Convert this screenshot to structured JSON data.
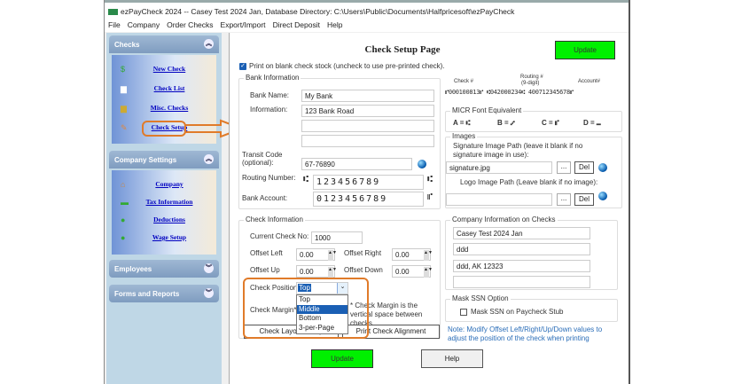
{
  "window": {
    "title": "ezPayCheck 2024 -- Casey Test 2024 Jan, Database Directory: C:\\Users\\Public\\Documents\\Halfpricesoft\\ezPayCheck"
  },
  "menu": [
    "File",
    "Company",
    "Order Checks",
    "Export/Import",
    "Direct Deposit",
    "Help"
  ],
  "sidebar": {
    "checks": {
      "title": "Checks",
      "items": [
        "New Check",
        "Check List",
        "Misc. Checks",
        "Check Setup"
      ]
    },
    "company_settings": {
      "title": "Company Settings",
      "items": [
        "Company",
        "Tax Information",
        "Deductions",
        "Wage Setup"
      ]
    },
    "employees": {
      "title": "Employees"
    },
    "forms": {
      "title": "Forms and Reports"
    }
  },
  "page": {
    "title": "Check Setup Page",
    "update_label": "Update",
    "help_label": "Help",
    "blank_stock_label": "Print on blank check stock (uncheck to use pre-printed check).",
    "blank_stock_checked": true
  },
  "bank": {
    "legend": "Bank Information",
    "name_label": "Bank Name:",
    "name": "My Bank",
    "info_label": "Information:",
    "info1": "123 Bank Road",
    "info2": "",
    "info3": "",
    "transit_label1": "Transit Code",
    "transit_label2": "(optional):",
    "transit": "67-76890",
    "routing_label": "Routing Number:",
    "routing": "123456789",
    "account_label": "Bank Account:",
    "account": "0123456789"
  },
  "micr_sample": {
    "check_label": "Check #",
    "routing_label": "Routing #",
    "routing_sub": "(9-digit)",
    "account_label": "Account#",
    "line": "⑈000100813⑈ ⑆042000234⑆ 400712345678⑈"
  },
  "micr_font": {
    "legend": "MICR Font Equivalent",
    "a": "A = ⑆",
    "b": "B = ⑇",
    "c": "C = ⑈",
    "d": "D = ⑉"
  },
  "images": {
    "legend": "Images",
    "sig_label": "Signature Image Path (leave it blank if no signature image in use):",
    "sig": "signature.jpg",
    "logo_label": "Logo Image Path (Leave blank if no image):",
    "logo": "",
    "browse": "...",
    "del": "Del"
  },
  "check_info": {
    "legend": "Check Information",
    "current_label": "Current Check No:",
    "current": "1000",
    "offset_left_label": "Offset Left",
    "offset_left": "0.00",
    "offset_right_label": "Offset Right",
    "offset_right": "0.00",
    "offset_up_label": "Offset Up",
    "offset_up": "0.00",
    "offset_down_label": "Offset Down",
    "offset_down": "0.00",
    "position_label": "Check Position",
    "position": "Top",
    "position_options": [
      "Top",
      "Middle",
      "Bottom",
      "3-per-Page"
    ],
    "margin_label": "Check Margin*:",
    "margin_note": "* Check Margin is the vertical space between checks.",
    "layout_btn": "Check Layout Setup",
    "align_btn": "Print Check Alignment"
  },
  "company_info": {
    "legend": "Company Information on Checks",
    "lines": [
      "Casey Test 2024 Jan",
      "ddd",
      "ddd, AK 12323",
      ""
    ]
  },
  "mask": {
    "legend": "Mask SSN Option",
    "label": "Mask SSN on Paycheck Stub",
    "checked": false
  },
  "note": "Note: Modify Offset Left/Right/Up/Down values to adjust the position of  the check when printing"
}
